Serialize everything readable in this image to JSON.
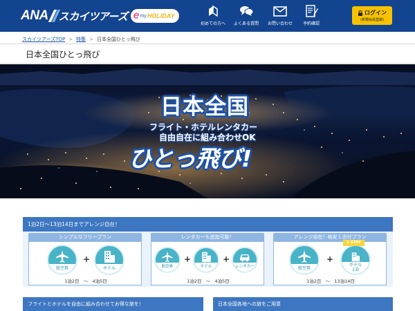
{
  "header": {
    "logo": {
      "brand": "ANA",
      "product": "スカイツアーズ",
      "sub_e": "e",
      "sub_my": "my",
      "sub_holiday": "HOLIDAY"
    },
    "nav": [
      {
        "label": "初めての方へ",
        "icon": "beginner-leaf-icon"
      },
      {
        "label": "よくある質問",
        "icon": "chat-bubbles-icon"
      },
      {
        "label": "お問い合わせ",
        "icon": "envelope-icon"
      },
      {
        "label": "予約確認",
        "icon": "document-pen-icon"
      }
    ],
    "login": {
      "label": "ログイン",
      "sub": "(新規会員登録)",
      "icon": "lock-icon",
      "color": "#f6c200"
    },
    "bg_color": "#13448f"
  },
  "breadcrumb": [
    {
      "label": "スカイツアーズTOP",
      "link": true
    },
    {
      "label": "特集",
      "link": true
    },
    {
      "label": "日本全国ひとっ飛び",
      "link": false
    }
  ],
  "page_title": "日本全国ひとっ飛び",
  "hero": {
    "title1": "日本全国",
    "line2": "フライト・ホテルレンタカー",
    "line3": "自由自在に組み合わせOK",
    "title2": "ひとっ飛び!"
  },
  "plans": {
    "header": "1泊2日～13泊14日までアレンジ自在！",
    "items": [
      {
        "title": "シンプルなフリープラン",
        "parts": [
          {
            "label": "航空券",
            "icon": "airplane-icon"
          },
          {
            "label": "ホテル",
            "icon": "building-icon"
          }
        ],
        "from": "1泊2日",
        "tilde": "～",
        "to": "4泊5日"
      },
      {
        "title": "レンタカーも追加可能！",
        "parts": [
          {
            "label": "航空券",
            "icon": "airplane-icon"
          },
          {
            "label": "ホテル",
            "icon": "building-icon"
          },
          {
            "label": "レンタカー",
            "icon": "car-icon"
          }
        ],
        "from": "1泊2日",
        "tilde": "～",
        "to": "4泊5日"
      },
      {
        "title": "アレンジ自在！格安１泊付プラン",
        "badge": "1 STAY",
        "parts": [
          {
            "label": "航空券",
            "icon": "airplane-icon"
          },
          {
            "label": "ホテル\n1泊",
            "icon": "building-icon"
          }
        ],
        "from": "1泊2日",
        "tilde": "～",
        "to": "13泊14日"
      }
    ]
  },
  "sections": [
    {
      "label": "フライトとホテルを自由に組み合わせてお得な旅を！"
    },
    {
      "label": "日本全国各地への旅をご用意"
    }
  ],
  "colors": {
    "accent": "#3d76c1",
    "plan_circle": "#49b3c8",
    "badge": "#f6d53d"
  }
}
